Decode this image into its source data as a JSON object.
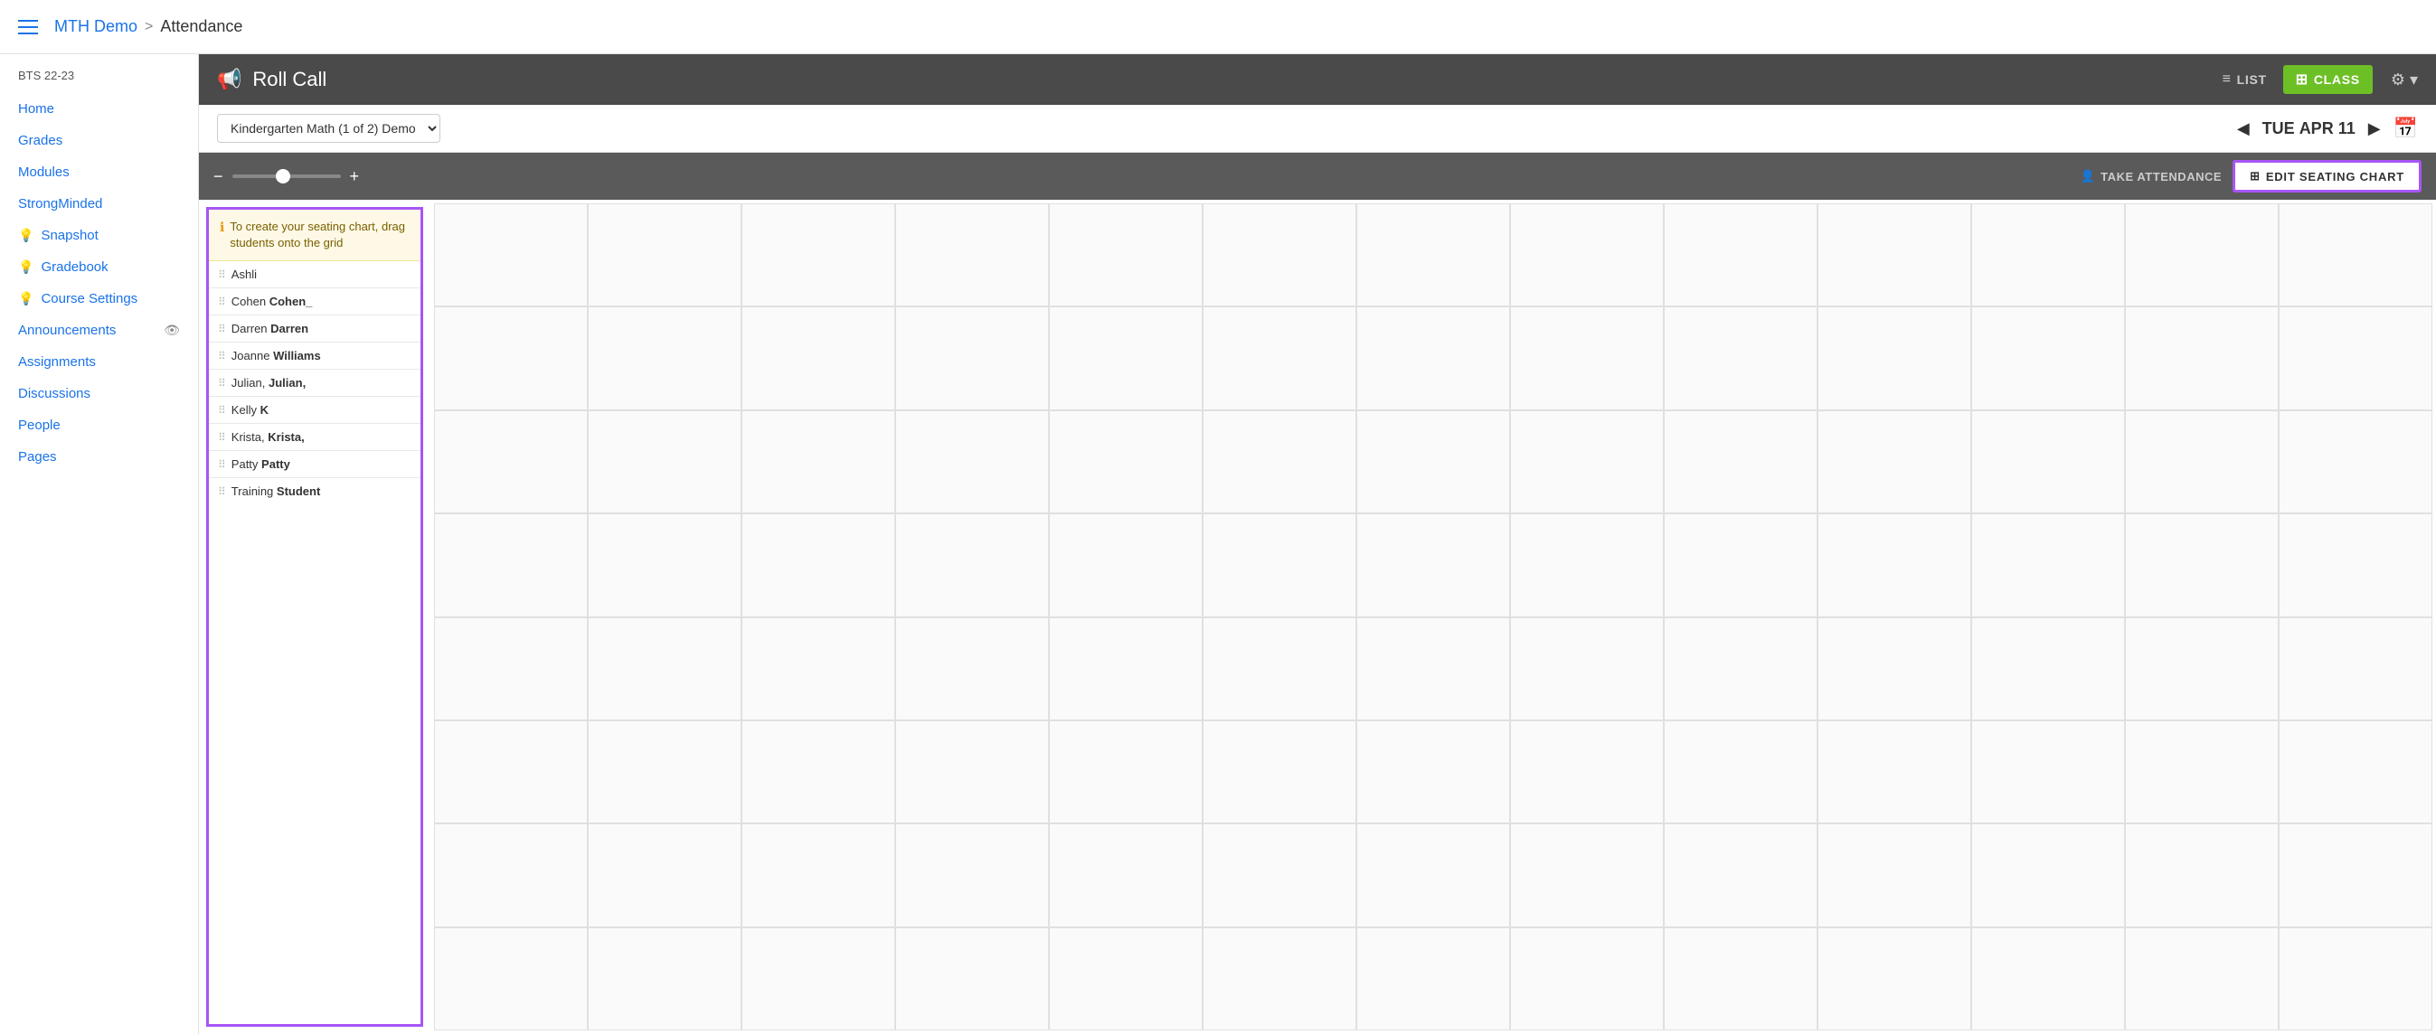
{
  "topNav": {
    "courseLink": "MTH Demo",
    "separator": ">",
    "currentPage": "Attendance"
  },
  "sidebar": {
    "courseLabel": "BTS 22-23",
    "items": [
      {
        "id": "home",
        "label": "Home",
        "icon": ""
      },
      {
        "id": "grades",
        "label": "Grades",
        "icon": ""
      },
      {
        "id": "modules",
        "label": "Modules",
        "icon": ""
      },
      {
        "id": "strong-minded",
        "label": "StrongMinded",
        "icon": ""
      },
      {
        "id": "snapshot",
        "label": "Snapshot",
        "icon": "💡"
      },
      {
        "id": "gradebook",
        "label": "Gradebook",
        "icon": "💡"
      },
      {
        "id": "course-settings",
        "label": "Course Settings",
        "icon": "💡"
      },
      {
        "id": "announcements",
        "label": "Announcements",
        "icon": "",
        "hasEye": true
      },
      {
        "id": "assignments",
        "label": "Assignments",
        "icon": ""
      },
      {
        "id": "discussions",
        "label": "Discussions",
        "icon": ""
      },
      {
        "id": "people",
        "label": "People",
        "icon": ""
      },
      {
        "id": "pages",
        "label": "Pages",
        "icon": ""
      }
    ]
  },
  "rollCall": {
    "title": "Roll Call",
    "listLabel": "LIST",
    "classLabel": "CLASS"
  },
  "controls": {
    "classSelect": "Kindergarten Math (1 of 2) Demo",
    "dateDay": "TUE",
    "dateMonth": "APR",
    "dateNum": "11"
  },
  "toolbar": {
    "takeAttendanceLabel": "TAKE ATTENDANCE",
    "editSeatingLabel": "EDIT SEATING CHART"
  },
  "studentPanel": {
    "hintText": "To create your seating chart, drag students onto the grid",
    "students": [
      {
        "first": "Ashli",
        "last": ""
      },
      {
        "first": "Cohen",
        "last": "Cohen_"
      },
      {
        "first": "Darren",
        "last": "Darren"
      },
      {
        "first": "Joanne",
        "last": "Williams"
      },
      {
        "first": "Julian,",
        "last": "Julian,"
      },
      {
        "first": "Kelly",
        "last": "K"
      },
      {
        "first": "Krista,",
        "last": "Krista,"
      },
      {
        "first": "Patty",
        "last": "Patty"
      },
      {
        "first": "Training",
        "last": "Student"
      }
    ]
  },
  "grid": {
    "cols": 13,
    "rows": 8
  }
}
